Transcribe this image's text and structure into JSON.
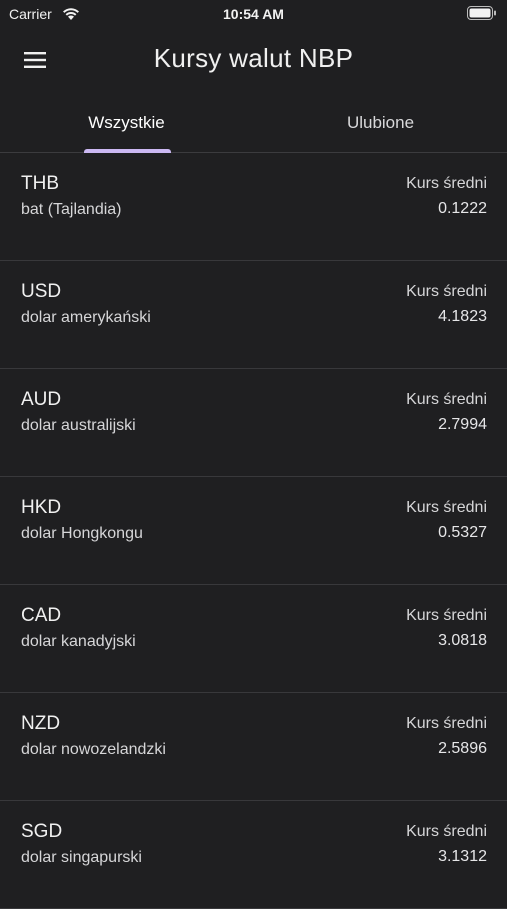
{
  "status_bar": {
    "carrier": "Carrier",
    "time": "10:54 AM",
    "wifi_icon": "wifi-icon",
    "battery_icon": "battery-icon"
  },
  "app_bar": {
    "title": "Kursy walut NBP",
    "menu_icon": "hamburger-menu-icon"
  },
  "tabs": [
    {
      "label": "Wszystkie",
      "active": true
    },
    {
      "label": "Ulubione",
      "active": false
    }
  ],
  "rates": [
    {
      "code": "THB",
      "name": "bat (Tajlandia)",
      "label": "Kurs średni",
      "value": "0.1222"
    },
    {
      "code": "USD",
      "name": "dolar amerykański",
      "label": "Kurs średni",
      "value": "4.1823"
    },
    {
      "code": "AUD",
      "name": "dolar australijski",
      "label": "Kurs średni",
      "value": "2.7994"
    },
    {
      "code": "HKD",
      "name": "dolar Hongkongu",
      "label": "Kurs średni",
      "value": "0.5327"
    },
    {
      "code": "CAD",
      "name": "dolar kanadyjski",
      "label": "Kurs średni",
      "value": "3.0818"
    },
    {
      "code": "NZD",
      "name": "dolar nowozelandzki",
      "label": "Kurs średni",
      "value": "2.5896"
    },
    {
      "code": "SGD",
      "name": "dolar singapurski",
      "label": "Kurs średni",
      "value": "3.1312"
    }
  ],
  "colors": {
    "background": "#1f1f21",
    "accent_indicator": "#cbb8f2",
    "divider": "#38383b"
  }
}
